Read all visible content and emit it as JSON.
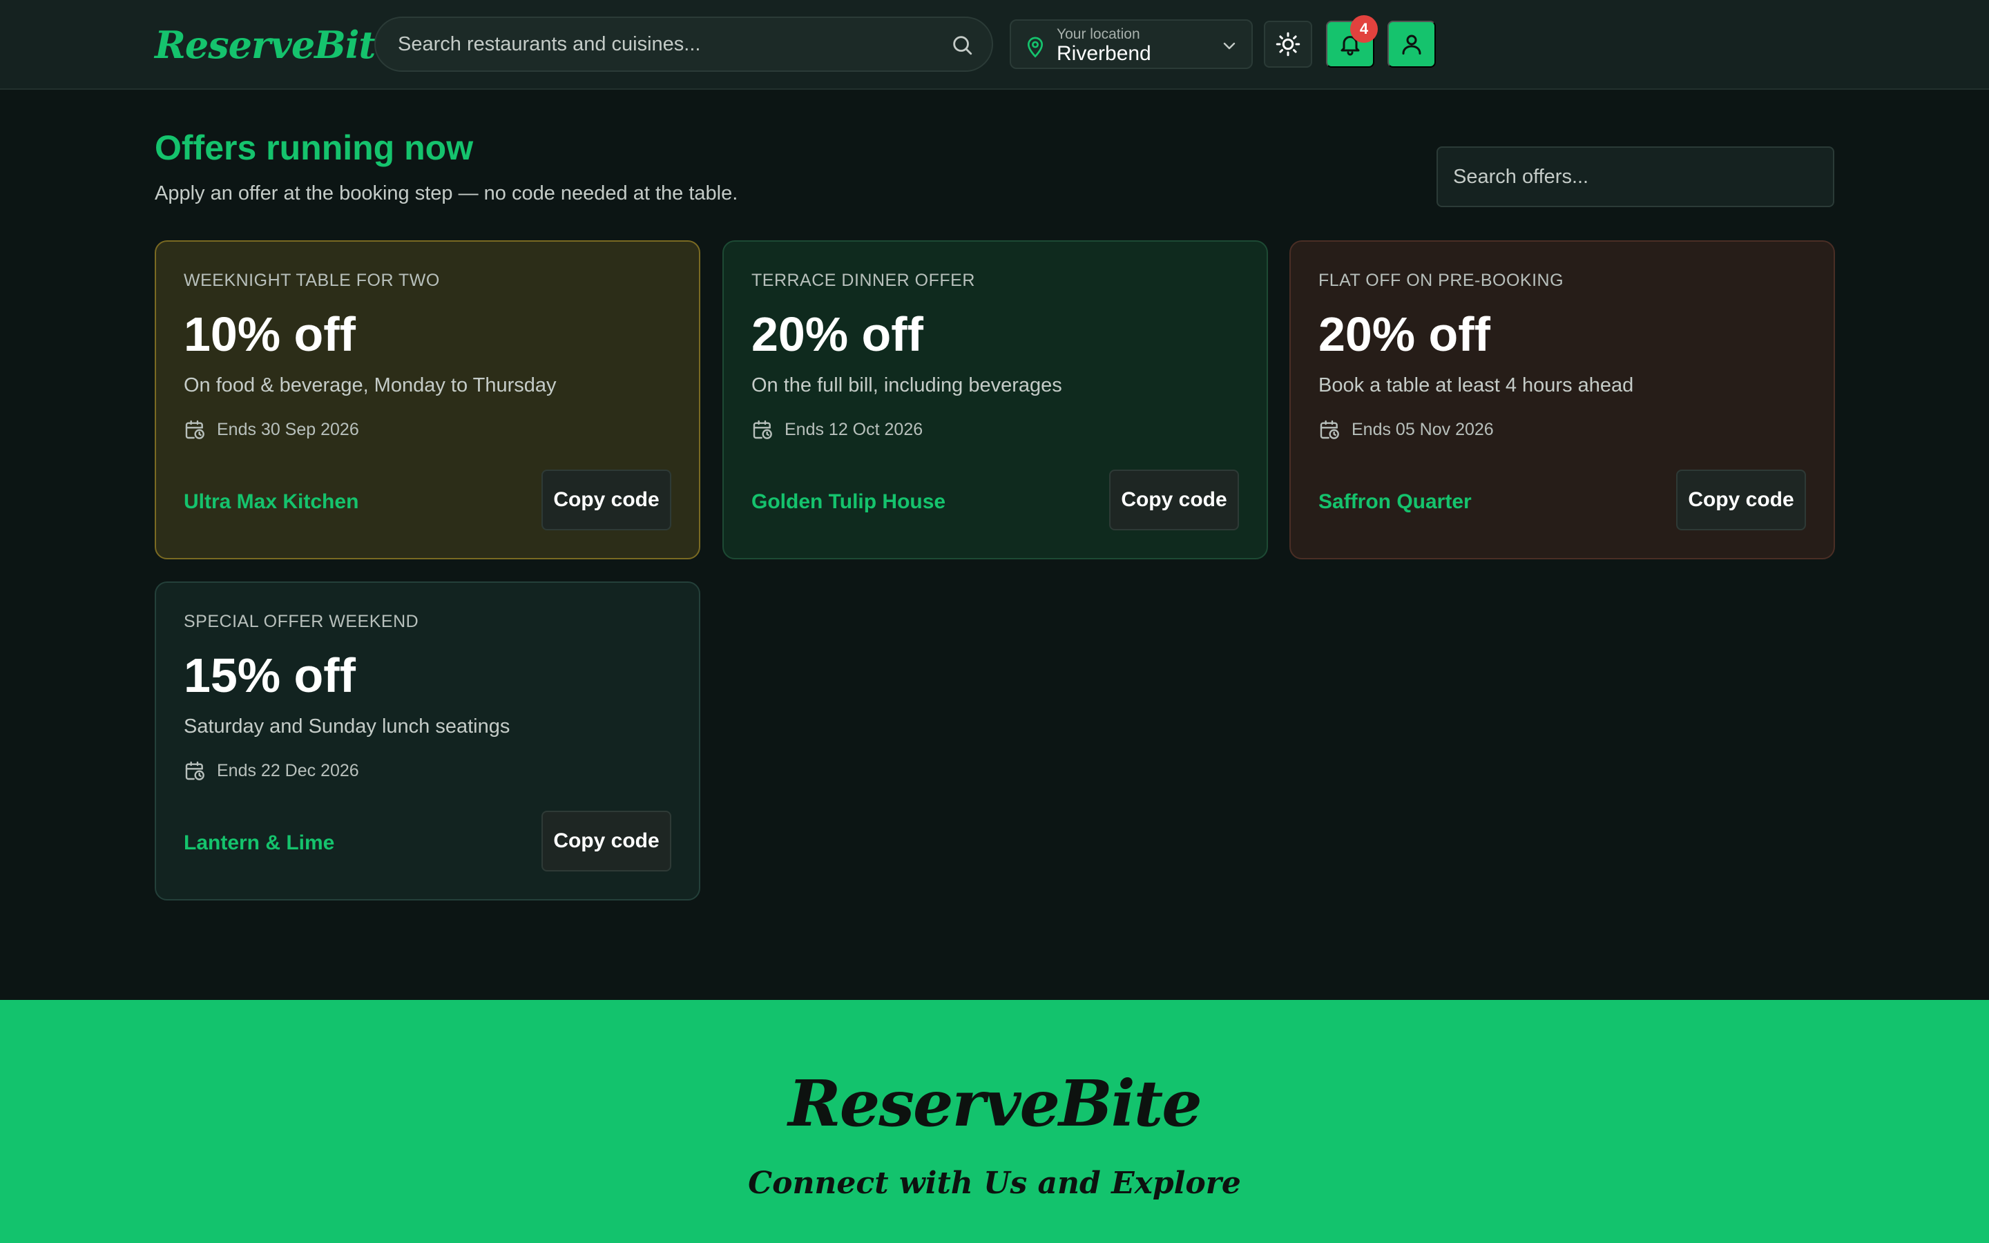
{
  "header": {
    "brand": "ReserveBite",
    "search_placeholder": "Search restaurants and cuisines...",
    "location_caption": "Your location",
    "location_value": "Riverbend",
    "notification_count": "4"
  },
  "main": {
    "title": "Offers running now",
    "subtitle": "Apply an offer at the booking step — no code needed at the table.",
    "offer_search_placeholder": "Search offers...",
    "offers": [
      {
        "eyebrow": "WEEKNIGHT TABLE FOR TWO",
        "headline": "10% off",
        "description": "On food & beverage, Monday to Thursday",
        "ends": "Ends 30 Sep 2026",
        "restaurant": "Ultra Max Kitchen",
        "button": "Copy code"
      },
      {
        "eyebrow": "TERRACE DINNER OFFER",
        "headline": "20% off",
        "description": "On the full bill, including beverages",
        "ends": "Ends 12 Oct 2026",
        "restaurant": "Golden Tulip House",
        "button": "Copy code"
      },
      {
        "eyebrow": "FLAT OFF ON PRE-BOOKING",
        "headline": "20% off",
        "description": "Book a table at least 4 hours ahead",
        "ends": "Ends 05 Nov 2026",
        "restaurant": "Saffron Quarter",
        "button": "Copy code"
      },
      {
        "eyebrow": "SPECIAL OFFER WEEKEND",
        "headline": "15% off",
        "description": "Saturday and Sunday lunch seatings",
        "ends": "Ends 22 Dec 2026",
        "restaurant": "Lantern & Lime",
        "button": "Copy code"
      }
    ]
  },
  "footer": {
    "brand": "ReserveBite",
    "tagline": "Connect with Us and Explore"
  },
  "colors": {
    "accent": "#15c36d",
    "background": "#0c1514",
    "badge": "#e2423e"
  },
  "icons": [
    "search-icon",
    "location-pin-icon",
    "chevron-down-icon",
    "sun-icon",
    "bell-icon",
    "user-icon",
    "calendar-clock-icon"
  ]
}
